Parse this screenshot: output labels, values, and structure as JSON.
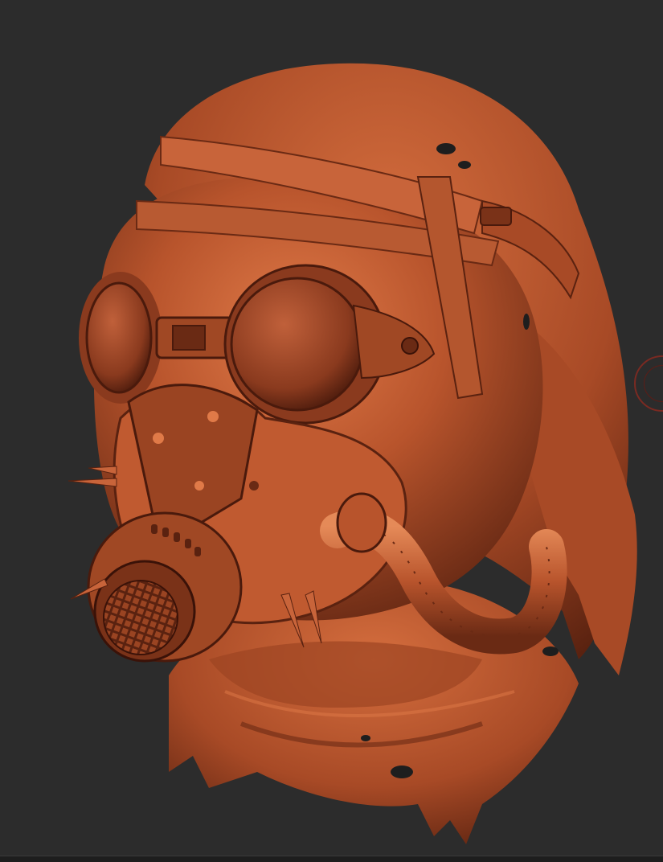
{
  "viewport": {
    "background_color": "#2c2c2c",
    "model_name": "",
    "material_base_color": "#b8542c",
    "material_shadow_color": "#5a2210",
    "material_highlight_color": "#e07a48",
    "gizmo_color": "#7a2a22"
  },
  "icons": {
    "model": "sculpted-gas-mask-head",
    "gizmo": "rotation-gizmo-ring"
  }
}
